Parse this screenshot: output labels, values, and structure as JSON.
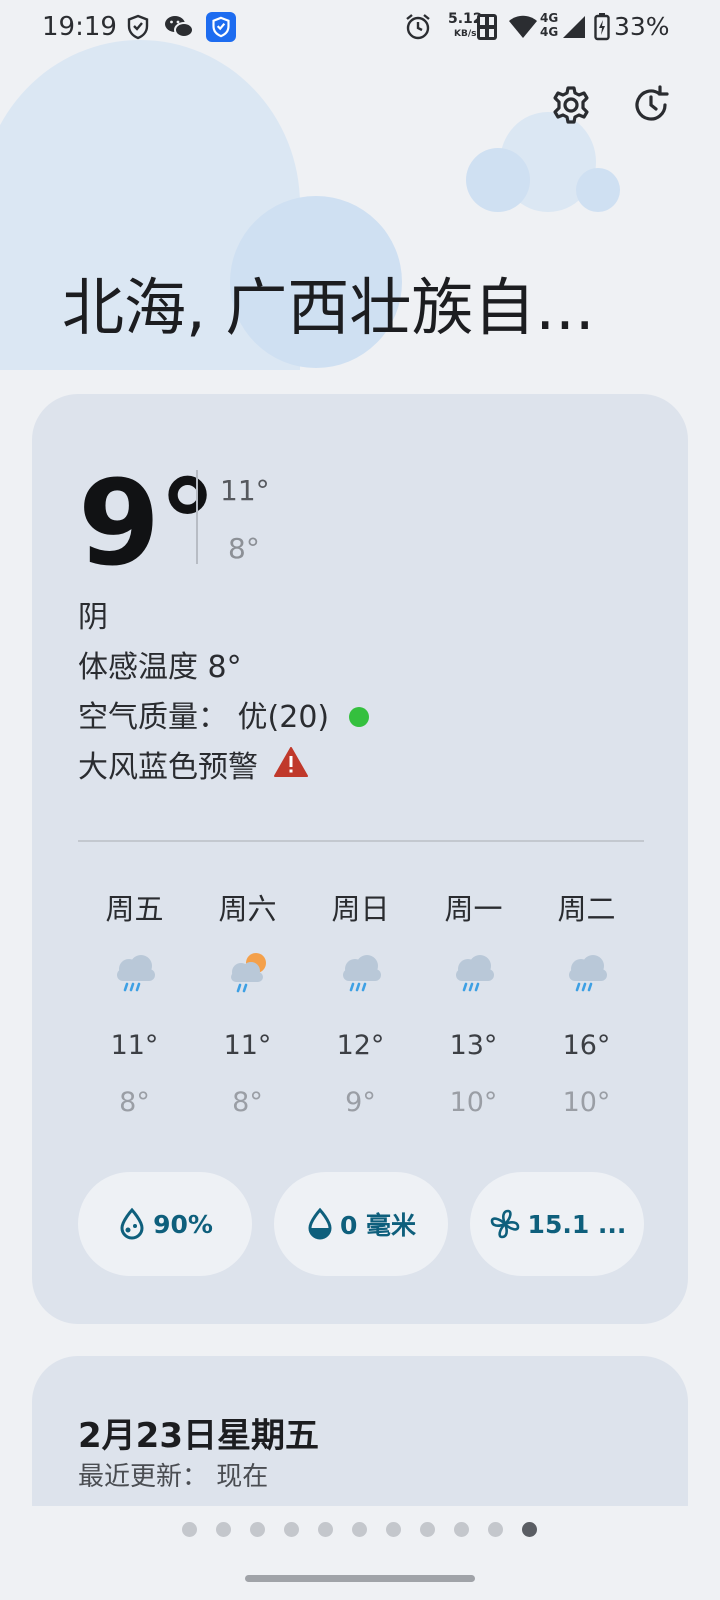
{
  "status_bar": {
    "time": "19:19",
    "net_speed_value": "5.12",
    "net_speed_unit": "KB/s",
    "network_1": "4G",
    "network_2": "4G",
    "battery": "33%",
    "icons": [
      "shield-icon",
      "wechat-icon",
      "vpn-shield-icon",
      "alarm-icon",
      "hd-icon",
      "wifi-icon",
      "signal-icon",
      "battery-icon"
    ]
  },
  "header": {
    "settings_icon": "gear-icon",
    "history_icon": "history-icon",
    "city": "北海, 广西壮族自..."
  },
  "current": {
    "temperature": "9°",
    "high": "11°",
    "low": "8°",
    "condition": "阴",
    "feels_like": "体感温度 8°",
    "air_quality_label": "空气质量：",
    "air_quality_value": "优(20)",
    "air_quality_color": "#34c03e",
    "warning": "大风蓝色预警",
    "warning_color": "#c0392b"
  },
  "forecast": [
    {
      "day": "周五",
      "icon": "rain-cloud-icon",
      "high": "11°",
      "low": "8°"
    },
    {
      "day": "周六",
      "icon": "sun-rain-cloud-icon",
      "high": "11°",
      "low": "8°"
    },
    {
      "day": "周日",
      "icon": "rain-cloud-icon",
      "high": "12°",
      "low": "9°"
    },
    {
      "day": "周一",
      "icon": "rain-cloud-icon",
      "high": "13°",
      "low": "10°"
    },
    {
      "day": "周二",
      "icon": "rain-cloud-icon",
      "high": "16°",
      "low": "10°"
    }
  ],
  "metrics": {
    "humidity": "90%",
    "precipitation": "0 毫米",
    "wind": "15.1 ..."
  },
  "date_card": {
    "date": "2月23日星期五",
    "updated": "最近更新：  现在"
  },
  "pager": {
    "total": 11,
    "active_index": 10
  },
  "colors": {
    "accent": "#0e5f7c",
    "card": "#dde3ec",
    "background": "#eff1f4"
  }
}
